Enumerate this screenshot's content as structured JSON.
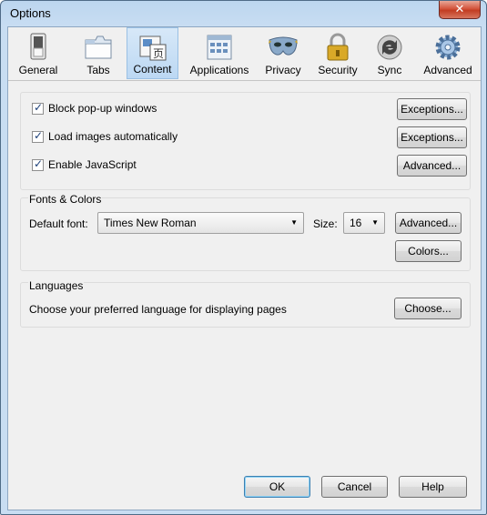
{
  "window": {
    "title": "Options",
    "close": "✕"
  },
  "tabs": [
    {
      "label": "General"
    },
    {
      "label": "Tabs"
    },
    {
      "label": "Content"
    },
    {
      "label": "Applications"
    },
    {
      "label": "Privacy"
    },
    {
      "label": "Security"
    },
    {
      "label": "Sync"
    },
    {
      "label": "Advanced"
    }
  ],
  "content": {
    "block_popups": {
      "label": "Block pop-up windows",
      "checked": true,
      "button": "Exceptions..."
    },
    "load_images": {
      "label": "Load images automatically",
      "checked": true,
      "button": "Exceptions..."
    },
    "enable_js": {
      "label": "Enable JavaScript",
      "checked": true,
      "button": "Advanced..."
    }
  },
  "fonts": {
    "heading": "Fonts & Colors",
    "default_font_label": "Default font:",
    "default_font_value": "Times New Roman",
    "size_label": "Size:",
    "size_value": "16",
    "advanced_button": "Advanced...",
    "colors_button": "Colors..."
  },
  "languages": {
    "heading": "Languages",
    "description": "Choose your preferred language for displaying pages",
    "choose_button": "Choose..."
  },
  "footer": {
    "ok": "OK",
    "cancel": "Cancel",
    "help": "Help"
  }
}
